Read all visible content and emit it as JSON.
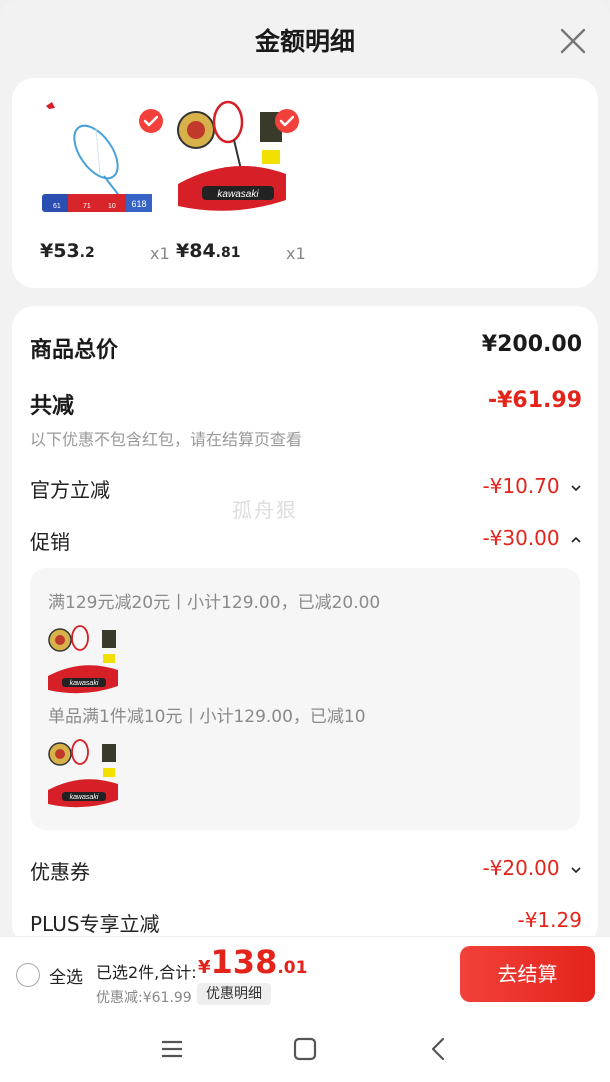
{
  "header": {
    "title": "金额明细"
  },
  "products": [
    {
      "price_int": "¥53",
      "price_dec": ".2",
      "qty": "x1",
      "brand_icon": "badminton-racket-blue"
    },
    {
      "price_int": "¥84",
      "price_dec": ".81",
      "qty": "x1",
      "brand_icon": "kawasaki-racket-bag"
    }
  ],
  "summary": {
    "total_label": "商品总价",
    "total_value": "¥200.00",
    "reduce_label": "共减",
    "reduce_value": "-¥61.99",
    "reduce_note": "以下优惠不包含红包，请在结算页查看",
    "official_label": "官方立减",
    "official_value": "-¥10.70",
    "promo_label": "促销",
    "promo_value": "-¥30.00",
    "promo_items": [
      {
        "text": "满129元减20元丨小计129.00，已减20.00"
      },
      {
        "text": "单品满1件减10元丨小计129.00，已减10"
      }
    ],
    "coupon_label": "优惠券",
    "coupon_value": "-¥20.00",
    "plus_label": "PLUS专享立减",
    "plus_value": "-¥1.29"
  },
  "watermark": "孤舟狠",
  "bottom": {
    "select_all": "全选",
    "selected_text": "已选2件,合计:",
    "total_currency": "¥",
    "total_int": "138",
    "total_dec": ".01",
    "discount_note": "优惠减:¥61.99",
    "detail_chip": "优惠明细",
    "checkout": "去结算"
  },
  "colors": {
    "accent": "#e3241b"
  }
}
